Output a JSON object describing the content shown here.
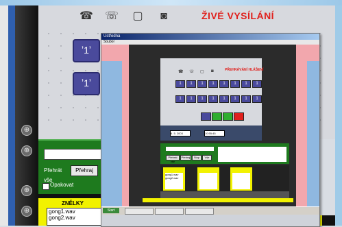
{
  "header": {
    "live_title": "ŽIVÉ VYSÍLÁNÍ"
  },
  "top_icons": [
    "phone-icon",
    "telephone-icon",
    "monitor-icon",
    "speaker-icon"
  ],
  "phone_buttons": [
    "ʼ1ʼ",
    "ʼ1ʼ"
  ],
  "player": {
    "prehrat_label": "Přehrát vše",
    "prehraj_label": "Přehraj",
    "opakovat_label": "Opakovat"
  },
  "zvonky": {
    "title": "ZNĚLKY",
    "files": [
      "gong1.wav",
      "gong2.wav"
    ]
  },
  "inner_window": {
    "title": "Ústředna",
    "menu": "Soubor",
    "live_title": "PŘEHRÁVÁNÍ HLÁŠENÍ",
    "date": "6. 5. 2003",
    "time": "10:55:45",
    "buttons": [
      "Přehrát vše",
      "Přehraj",
      "Stop",
      "Vše"
    ],
    "lists": [
      [
        "gong1.wav",
        "gong2.wav"
      ],
      [],
      []
    ],
    "start_label": "Start"
  },
  "colors": {
    "live_red": "#e0201c",
    "yellow": "#f2f200",
    "green": "#1e7a1e",
    "pink": "#f2a7ad",
    "blue_button": "#4a4a9c"
  }
}
